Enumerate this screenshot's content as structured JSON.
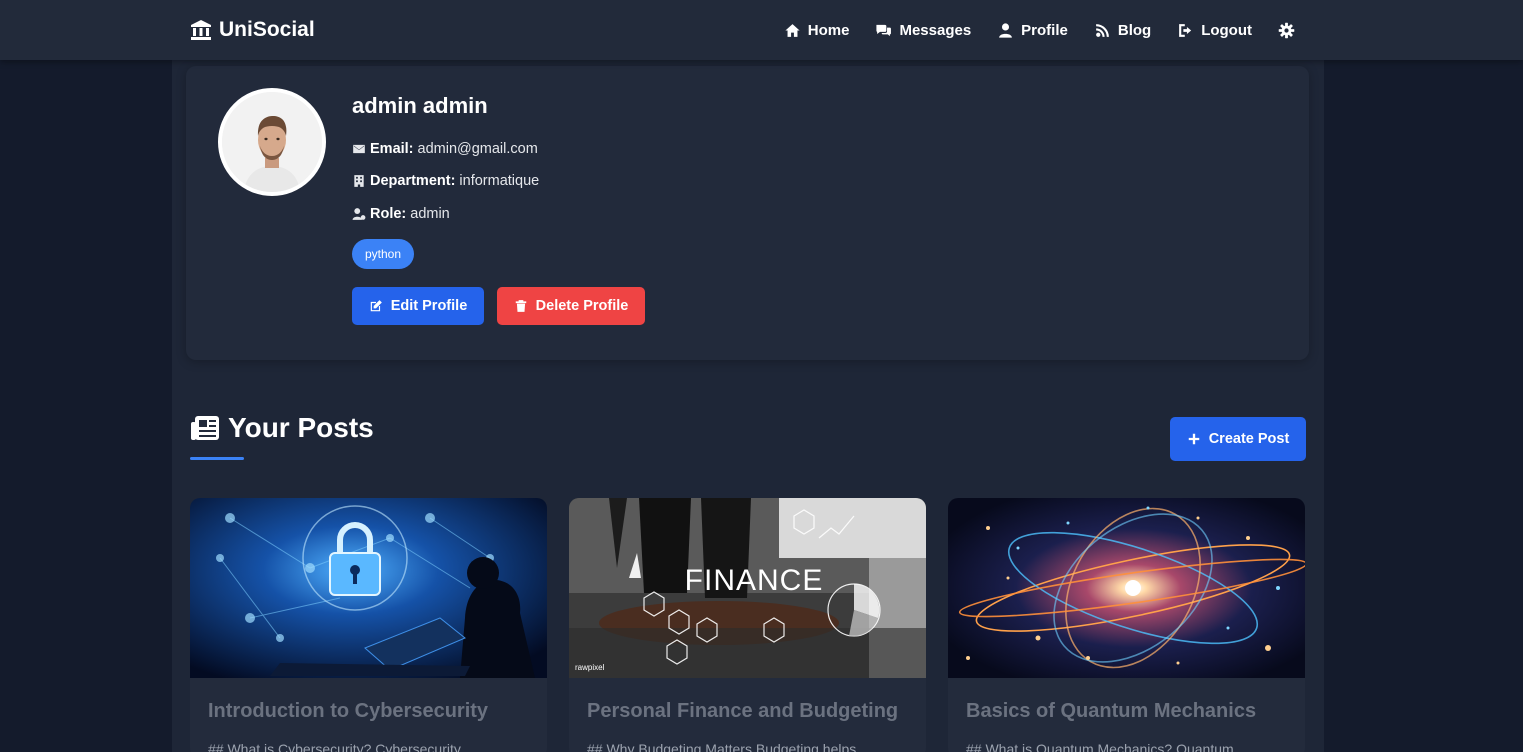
{
  "app": {
    "brand": "UniSocial"
  },
  "nav": {
    "items": [
      {
        "label": "Home",
        "icon": "home-icon"
      },
      {
        "label": "Messages",
        "icon": "messages-icon"
      },
      {
        "label": "Profile",
        "icon": "user-icon"
      },
      {
        "label": "Blog",
        "icon": "blog-icon"
      },
      {
        "label": "Logout",
        "icon": "logout-icon"
      }
    ],
    "theme_icon": "gear-icon"
  },
  "profile": {
    "name": "admin admin",
    "email_label": "Email:",
    "email": "admin@gmail.com",
    "department_label": "Department:",
    "department": "informatique",
    "role_label": "Role:",
    "role": "admin",
    "tags": [
      "python"
    ],
    "edit_label": "Edit Profile",
    "delete_label": "Delete Profile"
  },
  "posts": {
    "section_title": "Your Posts",
    "create_label": "Create Post",
    "items": [
      {
        "title": "Introduction to Cybersecurity",
        "excerpt": "## What is Cybersecurity? Cybersecurity",
        "image": "cybersecurity-image"
      },
      {
        "title": "Personal Finance and Budgeting",
        "excerpt": "## Why Budgeting Matters Budgeting helps",
        "image": "finance-image",
        "image_text": "FINANCE",
        "image_credit": "rawpixel"
      },
      {
        "title": "Basics of Quantum Mechanics",
        "excerpt": "## What is Quantum Mechanics? Quantum",
        "image": "quantum-image"
      }
    ]
  },
  "colors": {
    "primary": "#2563eb",
    "danger": "#ef4444",
    "tag": "#3b82f6",
    "navbar": "#222a3a",
    "background": "#141b2c"
  }
}
